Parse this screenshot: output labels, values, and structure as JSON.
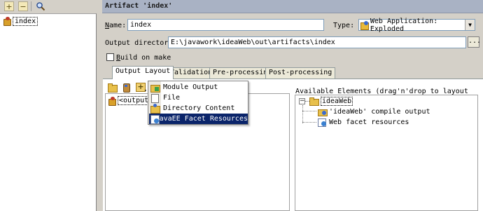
{
  "left_panel": {
    "add_icon": "plus-icon",
    "remove_icon": "minus-icon",
    "search_icon": "search-icon",
    "artifact_label": "index"
  },
  "header": {
    "title": "Artifact 'index'"
  },
  "form": {
    "name_label_first": "N",
    "name_label_rest": "ame:",
    "name_value": "index",
    "type_label": "Type:",
    "type_value": "Web Application: Exploded",
    "output_dir_label": "Output directory:",
    "output_dir_value": "E:\\javawork\\ideaWeb\\out\\artifacts\\index",
    "browse_label": "...",
    "build_label_first": "B",
    "build_label_rest": "uild on make",
    "build_checked": false
  },
  "tabs": [
    {
      "label": "Output Layout",
      "active": true
    },
    {
      "label": "Validation",
      "active": false
    },
    {
      "label": "Pre-processing",
      "active": false
    },
    {
      "label": "Post-processing",
      "active": false
    }
  ],
  "layout_tree": {
    "root_label": "<output r"
  },
  "popup_menu": {
    "items": [
      {
        "label": "Module Output",
        "icon": "module-output-icon",
        "selected": false
      },
      {
        "label": "File",
        "icon": "file-icon",
        "selected": false
      },
      {
        "label": "Directory Content",
        "icon": "directory-content-icon",
        "selected": false
      },
      {
        "label": "JavaEE Facet Resources",
        "icon": "facet-resources-icon",
        "selected": true
      }
    ]
  },
  "available": {
    "label": "Available Elements (drag'n'drop to layout tree)",
    "root": "ideaWeb",
    "children": [
      "'ideaWeb' compile output",
      "Web facet resources"
    ]
  }
}
